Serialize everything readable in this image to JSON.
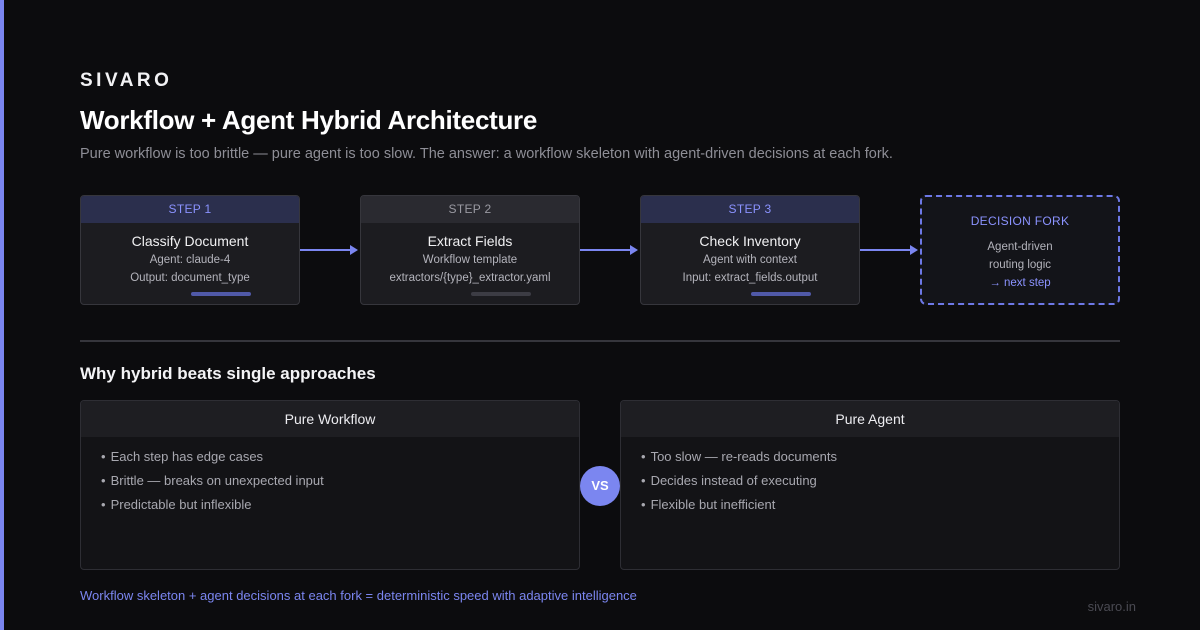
{
  "brand": "SIVARO",
  "title": "Workflow + Agent Hybrid Architecture",
  "subtitle": "Pure workflow is too brittle — pure agent is too slow. The answer: a workflow skeleton with agent-driven decisions at each fork.",
  "steps": [
    {
      "label": "STEP 1",
      "title": "Classify Document",
      "line1": "Agent: claude-4",
      "line2": "Output: document_type",
      "active": true
    },
    {
      "label": "STEP 2",
      "title": "Extract Fields",
      "line1": "Workflow template",
      "line2": "extractors/{type}_extractor.yaml",
      "active": false
    },
    {
      "label": "STEP 3",
      "title": "Check Inventory",
      "line1": "Agent with context",
      "line2": "Input: extract_fields.output",
      "active": true
    }
  ],
  "fork": {
    "label": "DECISION FORK",
    "line1": "Agent-driven",
    "line2": "routing logic",
    "line3": "→ next step"
  },
  "comparison": {
    "title": "Why hybrid beats single approaches",
    "left": {
      "title": "Pure Workflow",
      "items": [
        "Each step has edge cases",
        "Brittle — breaks on unexpected input",
        "Predictable but inflexible"
      ]
    },
    "vs": "VS",
    "right": {
      "title": "Pure Agent",
      "items": [
        "Too slow — re-reads documents",
        "Decides instead of executing",
        "Flexible but inefficient"
      ]
    }
  },
  "footer": {
    "note": "Workflow skeleton + agent decisions at each fork = deterministic speed with adaptive intelligence",
    "url": "sivaro.in"
  },
  "colors": {
    "accent": "#7b86f0",
    "background": "#0c0c0e",
    "card": "#1c1c20"
  }
}
